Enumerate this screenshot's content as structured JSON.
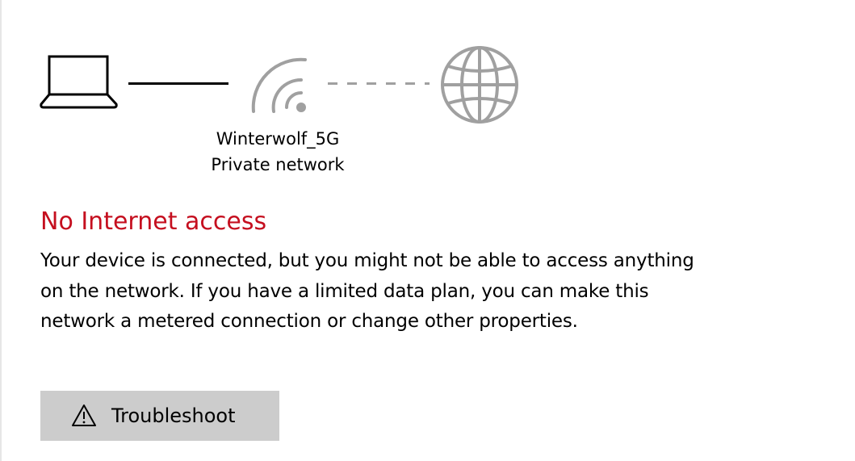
{
  "network": {
    "name": "Winterwolf_5G",
    "profile": "Private network"
  },
  "status": {
    "heading": "No Internet access",
    "description": "Your device is connected, but you might not be able to access anything on the network. If you have a limited data plan, you can make this network a metered connection or change other properties.",
    "heading_color": "#c50f1f"
  },
  "actions": {
    "troubleshoot_label": "Troubleshoot"
  },
  "icons": {
    "device": "laptop-icon",
    "connection": "wifi-icon",
    "internet": "globe-icon",
    "troubleshoot": "warning-icon"
  },
  "colors": {
    "connected_link": "#000000",
    "disconnected_link": "#a0a0a0",
    "inactive_icon": "#a0a0a0",
    "button_bg": "#cccccc"
  }
}
